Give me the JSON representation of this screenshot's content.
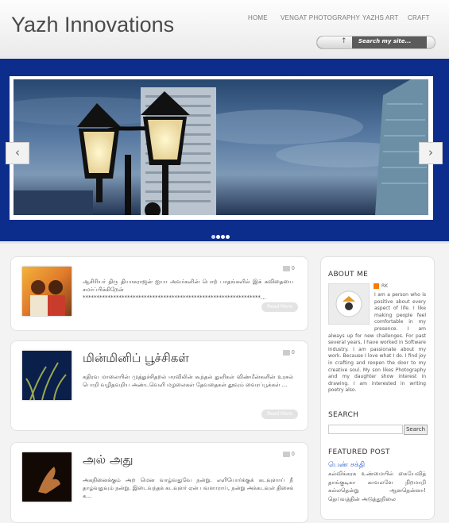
{
  "header": {
    "site_title": "Yazh Innovations",
    "nav": [
      "HOME",
      "VENGAT PHOTOGRAPHY",
      "YAZHS ART",
      "CRAFT"
    ],
    "search_placeholder": "Search my site..."
  },
  "slider": {
    "active_dot": 0,
    "dot_count": 4
  },
  "posts": [
    {
      "title": "",
      "comments": "0",
      "excerpt": "ஆசிரியர் திரு தியாகராஜன் ஐயா அவர்களின் பொற் பாதங்களில் இக் கவிதையை சமர்ப்பிக்கிறேன் ****************************************************************...",
      "read_more": "Read More"
    },
    {
      "title": "மின்மினிப் பூச்சிகள்",
      "comments": "0",
      "excerpt": "கதிரவ மாலையின் முத்துச்சிதறல் ஈரவிலின் கூந்தல் துளிகள் விண்மீன்களின் உரசல் பொறி வழிதவறிய அண்டவெளி மழலைகள் தேவதைகள் தூவும் வைரப்பூக்கள் ...",
      "read_more": "Read More"
    },
    {
      "title": "அல் அது",
      "comments": "0",
      "excerpt": "அகநினைக்கும் அற மென வாழ்வதுவே நன்று. எளியோர்க்குக் கடவுளாய் நீ தாழ்வதுவும் நன்று. இடைவந்தக் கடவுளர் ஏன் பவளாராய், நன்று அக்கடவுள் திசைக் க...",
      "read_more": "Read More"
    }
  ],
  "sidebar": {
    "about_heading": "ABOUT ME",
    "blogger_name": "RK",
    "about_text": "I am a person who is positive about every aspect of life. I like making people feel comfortable in my presence. I am always up for new challenges. For past several years, I have worked in Software Industry. I am passionate about my work. Because I love what I do. I find joy in crafting and reopen the door to my creative soul. My son likes Photography and my daughter show interest in drawing. I am interested in writing poetry also.",
    "search_heading": "SEARCH",
    "search_button": "Search",
    "featured_heading": "FEATURED POST",
    "featured_title": "பெண் சக்தி",
    "featured_text": "கல்விக்கரக உண்மையில் கையேவித் தாங்குடிகா காவலளே நிறமாறி கல்லதென்று ஆனதென்னா! தெய்வத்தின் அடுத்துநிலை"
  },
  "icons": {
    "prev": "chevron-left-icon",
    "next": "chevron-right-icon",
    "comment": "comment-icon"
  },
  "colors": {
    "banner_blue": "#0d2d8c",
    "link_blue": "#3366cc"
  }
}
